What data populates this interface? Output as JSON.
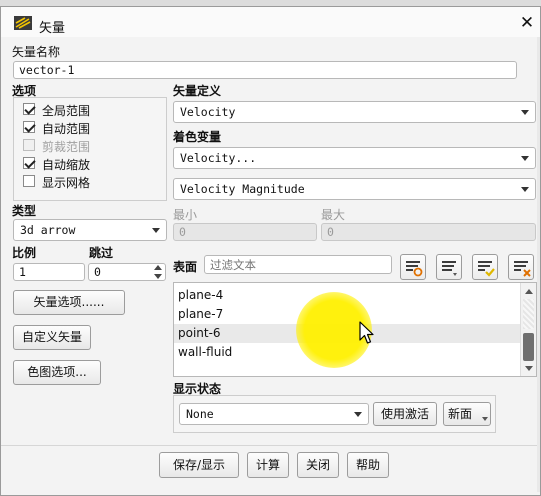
{
  "window": {
    "title": "矢量",
    "close_glyph": "✕"
  },
  "vector_name": {
    "label": "矢量名称",
    "value": "vector-1"
  },
  "options": {
    "label": "选项",
    "items": [
      {
        "label": "全局范围",
        "checked": true,
        "enabled": true
      },
      {
        "label": "自动范围",
        "checked": true,
        "enabled": true
      },
      {
        "label": "剪裁范围",
        "checked": false,
        "enabled": false
      },
      {
        "label": "自动缩放",
        "checked": true,
        "enabled": true
      },
      {
        "label": "显示网格",
        "checked": false,
        "enabled": true
      }
    ]
  },
  "type": {
    "label": "类型",
    "value": "3d arrow"
  },
  "scale": {
    "label": "比例",
    "value": "1"
  },
  "skip": {
    "label": "跳过",
    "value": "0"
  },
  "buttons": {
    "vector_options": "矢量选项......",
    "custom_vectors": "自定义矢量",
    "colormap_options": "色图选项...",
    "use_active": "使用激活",
    "new": "新面",
    "save_display": "保存/显示",
    "compute": "计算",
    "close": "关闭",
    "help": "帮助"
  },
  "vector_definition": {
    "label": "矢量定义",
    "value": "Velocity"
  },
  "color_variable": {
    "label": "着色变量",
    "value": "Velocity...",
    "sub_value": "Velocity Magnitude"
  },
  "range": {
    "min_label": "最小",
    "min_value": "0",
    "max_label": "最大",
    "max_value": "0"
  },
  "surfaces": {
    "label": "表面",
    "filter_placeholder": "过滤文本",
    "items": [
      "plane-4",
      "plane-7",
      "point-6",
      "wall-fluid"
    ],
    "highlighted": "point-6"
  },
  "display_state": {
    "label": "显示状态",
    "value": "None"
  },
  "colors": {
    "highlight": "#fff200",
    "check_yellow": "#e0b800",
    "orange": "#e07000"
  }
}
